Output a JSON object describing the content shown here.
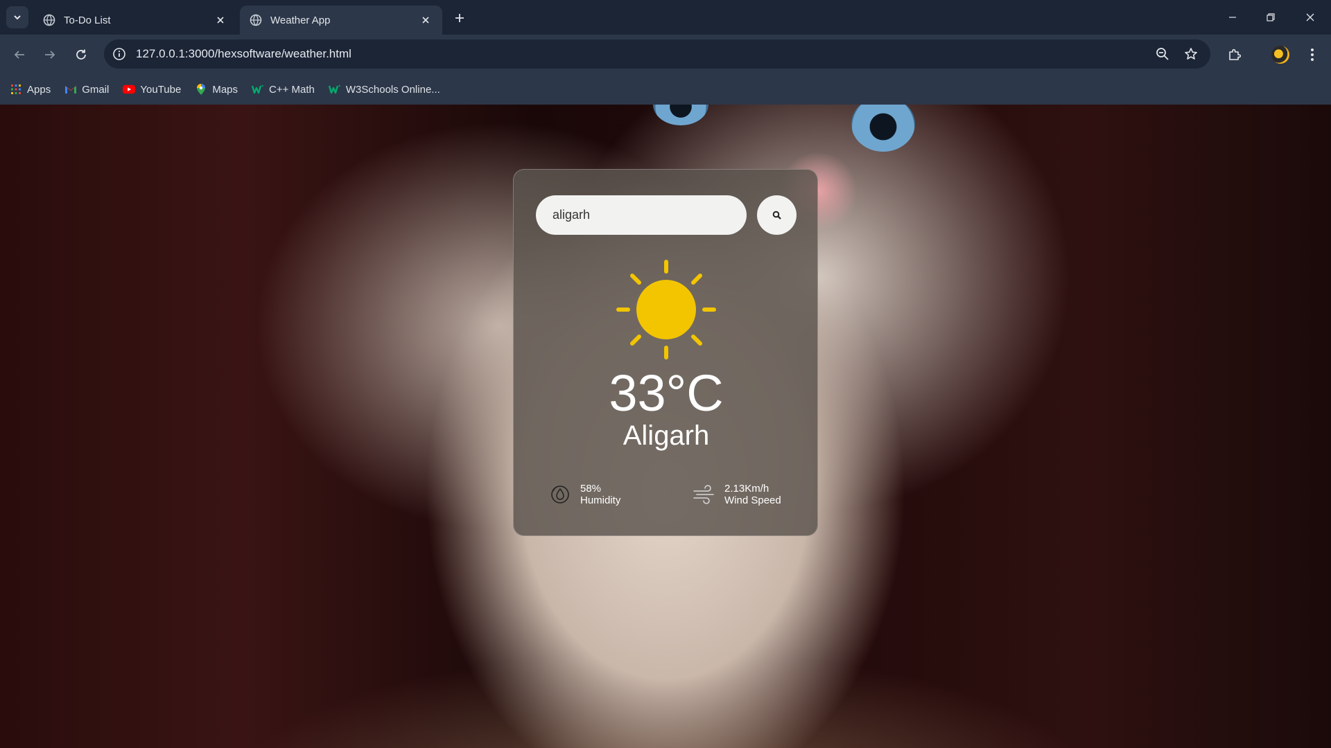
{
  "browser": {
    "tabs": [
      {
        "title": "To-Do List",
        "active": false
      },
      {
        "title": "Weather App",
        "active": true
      }
    ],
    "url": "127.0.0.1:3000/hexsoftware/weather.html",
    "bookmarks": [
      {
        "label": "Apps",
        "icon": "apps-grid-icon"
      },
      {
        "label": "Gmail",
        "icon": "gmail-icon"
      },
      {
        "label": "YouTube",
        "icon": "youtube-icon"
      },
      {
        "label": "Maps",
        "icon": "maps-pin-icon"
      },
      {
        "label": "C++ Math",
        "icon": "w3schools-icon"
      },
      {
        "label": "W3Schools Online...",
        "icon": "w3schools-icon"
      }
    ]
  },
  "weather": {
    "search_value": "aligarh",
    "temperature": "33°C",
    "city": "Aligarh",
    "humidity_value": "58%",
    "humidity_label": "Humidity",
    "wind_value": "2.13Km/h",
    "wind_label": "Wind Speed",
    "condition_icon": "sun-icon"
  },
  "colors": {
    "chrome_dark": "#1b2536",
    "chrome_light": "#2c3749",
    "card_bg": "rgba(92,84,78,0.82)",
    "sun": "#f2c500"
  }
}
